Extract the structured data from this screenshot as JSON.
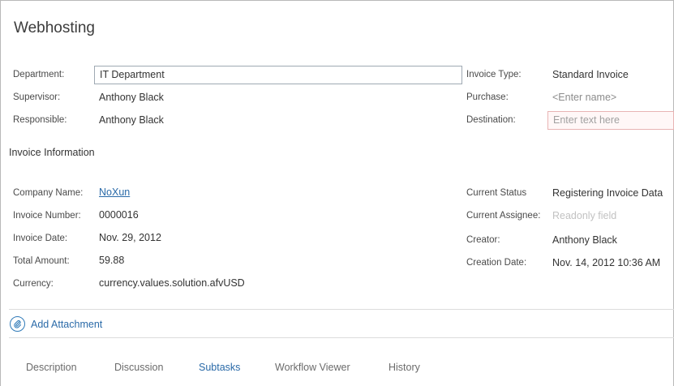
{
  "title": "Webhosting",
  "header_fields": {
    "department": {
      "label": "Department:",
      "value": "IT Department"
    },
    "supervisor": {
      "label": "Supervisor:",
      "value": "Anthony Black"
    },
    "responsible": {
      "label": "Responsible:",
      "value": "Anthony Black"
    },
    "invoice_type": {
      "label": "Invoice Type:",
      "value": "Standard Invoice"
    },
    "purchase": {
      "label": "Purchase:",
      "placeholder": "<Enter name>"
    },
    "destination": {
      "label": "Destination:",
      "placeholder": "Enter text here"
    }
  },
  "invoice_section": {
    "title": "Invoice Information",
    "company_name": {
      "label": "Company Name:",
      "value": "NoXun"
    },
    "invoice_number": {
      "label": "Invoice Number:",
      "value": "0000016"
    },
    "invoice_date": {
      "label": "Invoice Date:",
      "value": "Nov. 29, 2012"
    },
    "total_amount": {
      "label": "Total Amount:",
      "value": "59.88"
    },
    "currency": {
      "label": "Currency:",
      "value": "currency.values.solution.afvUSD"
    },
    "current_status": {
      "label": "Current Status",
      "value": "Registering Invoice Data"
    },
    "current_assignee": {
      "label": "Current Assignee:",
      "value": "Readonly field"
    },
    "creator": {
      "label": "Creator:",
      "value": "Anthony Black"
    },
    "creation_date": {
      "label": "Creation Date:",
      "value": "Nov. 14, 2012 10:36 AM"
    }
  },
  "attachment": {
    "label": "Add Attachment",
    "icon": "attachment-icon"
  },
  "tabs": [
    {
      "label": "Description"
    },
    {
      "label": "Discussion"
    },
    {
      "label": "Subtasks"
    },
    {
      "label": "Workflow Viewer"
    },
    {
      "label": "History"
    }
  ],
  "colors": {
    "link": "#2a6aa8",
    "accent": "#2f7ab8",
    "error_border": "#e8b4b4"
  }
}
